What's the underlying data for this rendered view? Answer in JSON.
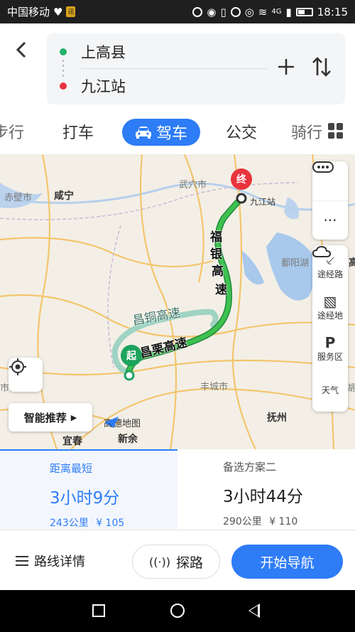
{
  "status_bar": {
    "carrier": "中国移动",
    "badge": "讯",
    "time": "18:15",
    "network": "4G"
  },
  "route": {
    "from": "上高县",
    "to": "九江站"
  },
  "tabs": {
    "walk": "步行",
    "taxi": "打车",
    "drive": "驾车",
    "bus": "公交",
    "bike": "骑行"
  },
  "map": {
    "labels": {
      "chibi": "赤壁市",
      "xianning": "咸宁",
      "wuxue": "武穴市",
      "jiujiang_station": "九江站",
      "poyang_lake": "鄱阳湖",
      "fengcheng": "丰城市",
      "fuzhou": "抚州",
      "yichun": "宜春",
      "xinyu": "新余",
      "left_edge": "市",
      "right_edge": "湖",
      "right_edge2": "高"
    },
    "route_labels": {
      "main_north": [
        "福",
        "银",
        "高",
        "速"
      ],
      "main_south": "昌栗高速",
      "alt": "昌铜高速"
    },
    "markers": {
      "start": "起",
      "end": "终"
    },
    "logo": "高德地图",
    "smart_recommend": "智能推荐",
    "controls": {
      "waypoint": "途经路",
      "via_place": "途经地",
      "service_area": "服务区",
      "weather": "天气"
    },
    "colors": {
      "route_main": "#2da44e",
      "route_alt": "#9fd3c3",
      "water": "#a8c8ec",
      "road": "#f7c46a"
    }
  },
  "plans": [
    {
      "title": "距离最短",
      "time": "3小时9分",
      "distance": "243公里",
      "cost": "¥ 105",
      "active": true
    },
    {
      "title": "备选方案二",
      "time": "3小时44分",
      "distance": "290公里",
      "cost": "¥ 110",
      "active": false
    }
  ],
  "actions": {
    "detail": "路线详情",
    "explore": "探路",
    "navigate": "开始导航"
  },
  "accent_color": "#2e7cf6"
}
